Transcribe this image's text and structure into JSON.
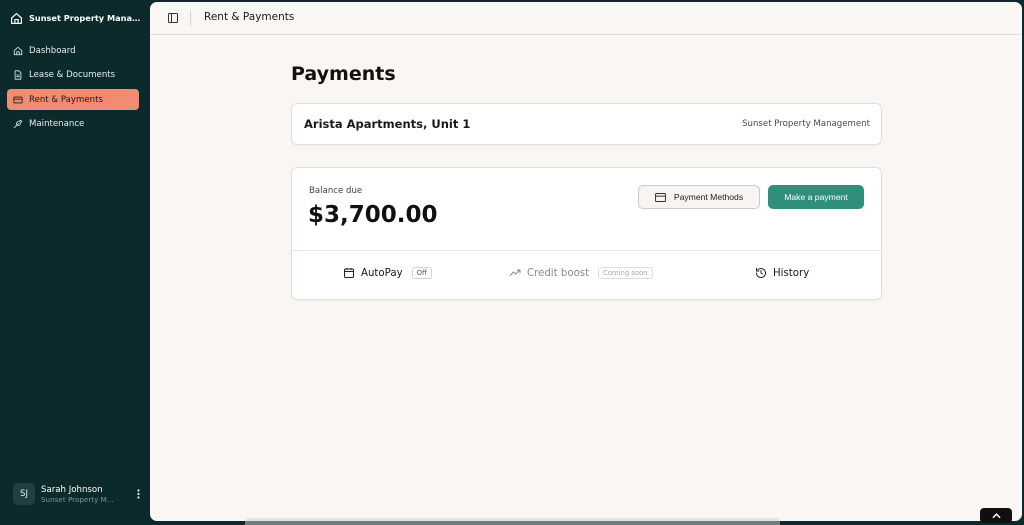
{
  "sidebar": {
    "brand": "Sunset Property Manage...",
    "items": [
      {
        "label": "Dashboard",
        "icon": "home-icon",
        "active": false
      },
      {
        "label": "Lease & Documents",
        "icon": "document-icon",
        "active": false
      },
      {
        "label": "Rent & Payments",
        "icon": "card-icon",
        "active": true
      },
      {
        "label": "Maintenance",
        "icon": "wrench-icon",
        "active": false
      }
    ],
    "user": {
      "initials": "SJ",
      "name": "Sarah Johnson",
      "org": "Sunset Property M..."
    }
  },
  "topbar": {
    "breadcrumb": "Rent & Payments"
  },
  "page": {
    "title": "Payments"
  },
  "property": {
    "name": "Arista Apartments, Unit 1",
    "manager": "Sunset Property Management"
  },
  "balance": {
    "label": "Balance due",
    "amount": "$3,700.00",
    "payment_methods_label": "Payment Methods",
    "make_payment_label": "Make a payment"
  },
  "features": {
    "autopay_label": "AutoPay",
    "autopay_status": "Off",
    "credit_label": "Credit boost",
    "credit_status": "Coming soon",
    "history_label": "History"
  },
  "colors": {
    "sidebar_bg": "#0c2a2c",
    "active_nav": "#f38b72",
    "primary": "#2f8f7b",
    "page_bg": "#faf6f3"
  }
}
